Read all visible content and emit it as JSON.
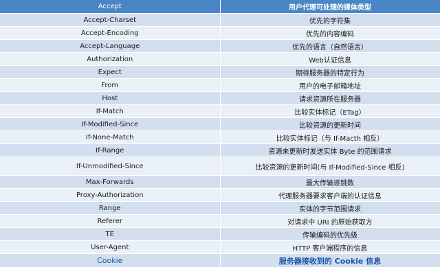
{
  "header": {
    "col1": "Accept",
    "col2": "用户代理可处理的媒体类型"
  },
  "rows": [
    {
      "name": "Accept-Charset",
      "desc": "优先的字符集"
    },
    {
      "name": "Accept-Encoding",
      "desc": "优先的内容编码"
    },
    {
      "name": "Accept-Language",
      "desc": "优先的语言（自然语言）"
    },
    {
      "name": "Authorization",
      "desc": "Web认证信息"
    },
    {
      "name": "Expect",
      "desc": "期待服务器的特定行为"
    },
    {
      "name": "From",
      "desc": "用户的电子邮箱地址"
    },
    {
      "name": "Host",
      "desc": "请求资源所在服务器"
    },
    {
      "name": "If-Match",
      "desc": "比较实体标记（ETag）"
    },
    {
      "name": "If-Modified-Since",
      "desc": "比较资源的更新时间"
    },
    {
      "name": "If-None-Match",
      "desc": "比较实体标记（与 If-Macth 相反）"
    },
    {
      "name": "If-Range",
      "desc": "资源未更新时发送实体 Byte 的范围请求"
    },
    {
      "name": "If-Unmodified-Since",
      "desc": "比较资源的更新时间(与 If-Modified-Since 相反)"
    },
    {
      "name": "Max-Forwards",
      "desc": "最大传输逐跳数"
    },
    {
      "name": "Proxy-Authorization",
      "desc": "代理服务器要求客户端的认证信息"
    },
    {
      "name": "Range",
      "desc": "实体的字节范围请求"
    },
    {
      "name": "Referer",
      "desc": "对请求中 URI 的原始获取方"
    },
    {
      "name": "TE",
      "desc": "传输编码的优先级"
    },
    {
      "name": "User-Agent",
      "desc": "HTTP 客户端程序的信息"
    },
    {
      "name": "Cookie",
      "desc": "服务器接收到的 Cookie 信息"
    }
  ]
}
